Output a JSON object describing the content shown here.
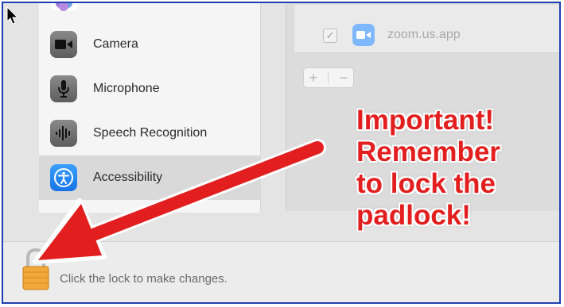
{
  "sidebar": {
    "items": [
      {
        "label": "Camera",
        "icon": "camera-icon"
      },
      {
        "label": "Microphone",
        "icon": "microphone-icon"
      },
      {
        "label": "Speech Recognition",
        "icon": "speech-waveform-icon"
      },
      {
        "label": "Accessibility",
        "icon": "accessibility-icon",
        "selected": true
      }
    ]
  },
  "app_list": {
    "apps": [
      {
        "name": "zoom.us.app",
        "checked": true,
        "icon": "zoom-icon"
      }
    ],
    "add_symbol": "+",
    "remove_symbol": "−"
  },
  "footer": {
    "lock_text": "Click the lock to make changes.",
    "lock_icon": "padlock-icon"
  },
  "annotation": {
    "lines": [
      "Important!",
      "Remember",
      "to lock the",
      "padlock!"
    ],
    "color": "#e31e1e"
  },
  "colors": {
    "selection": "#d9d9d9",
    "accent_blue": "#1673e6",
    "frame_border": "#1f3fb0"
  }
}
